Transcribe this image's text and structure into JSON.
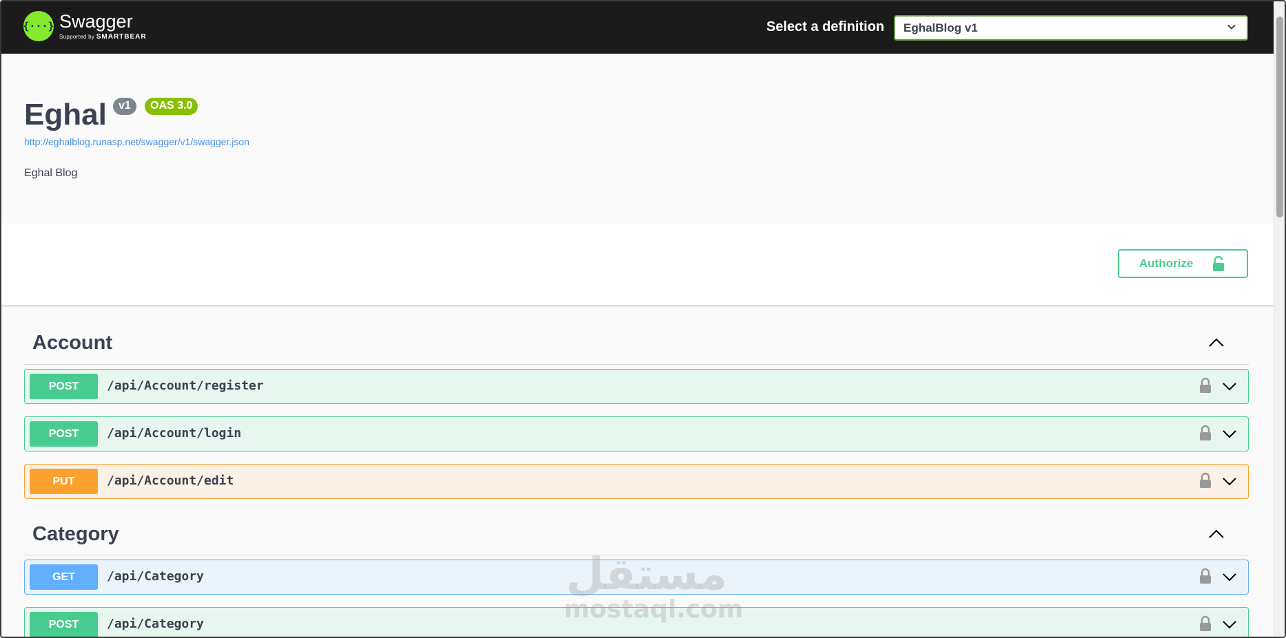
{
  "topbar": {
    "logo_title": "Swagger",
    "logo_sub_prefix": "Supported by",
    "logo_sub_brand": "SMARTBEAR",
    "definition_label": "Select a definition",
    "definition_selected": "EghalBlog v1"
  },
  "info": {
    "title": "Eghal",
    "version": "v1",
    "oas": "OAS 3.0",
    "spec_url": "http://eghalblog.runasp.net/swagger/v1/swagger.json",
    "description": "Eghal Blog"
  },
  "authorize_label": "Authorize",
  "tags": [
    {
      "name": "Account",
      "operations": [
        {
          "method": "POST",
          "path": "/api/Account/register"
        },
        {
          "method": "POST",
          "path": "/api/Account/login"
        },
        {
          "method": "PUT",
          "path": "/api/Account/edit"
        }
      ]
    },
    {
      "name": "Category",
      "operations": [
        {
          "method": "GET",
          "path": "/api/Category"
        },
        {
          "method": "POST",
          "path": "/api/Category"
        }
      ]
    }
  ],
  "watermark": {
    "arabic": "مستقل",
    "latin": "mostaql.com"
  },
  "colors": {
    "post": "#49cc90",
    "put": "#fca130",
    "get": "#61affe",
    "topbar": "#1b1b1b",
    "link": "#4990e2"
  }
}
